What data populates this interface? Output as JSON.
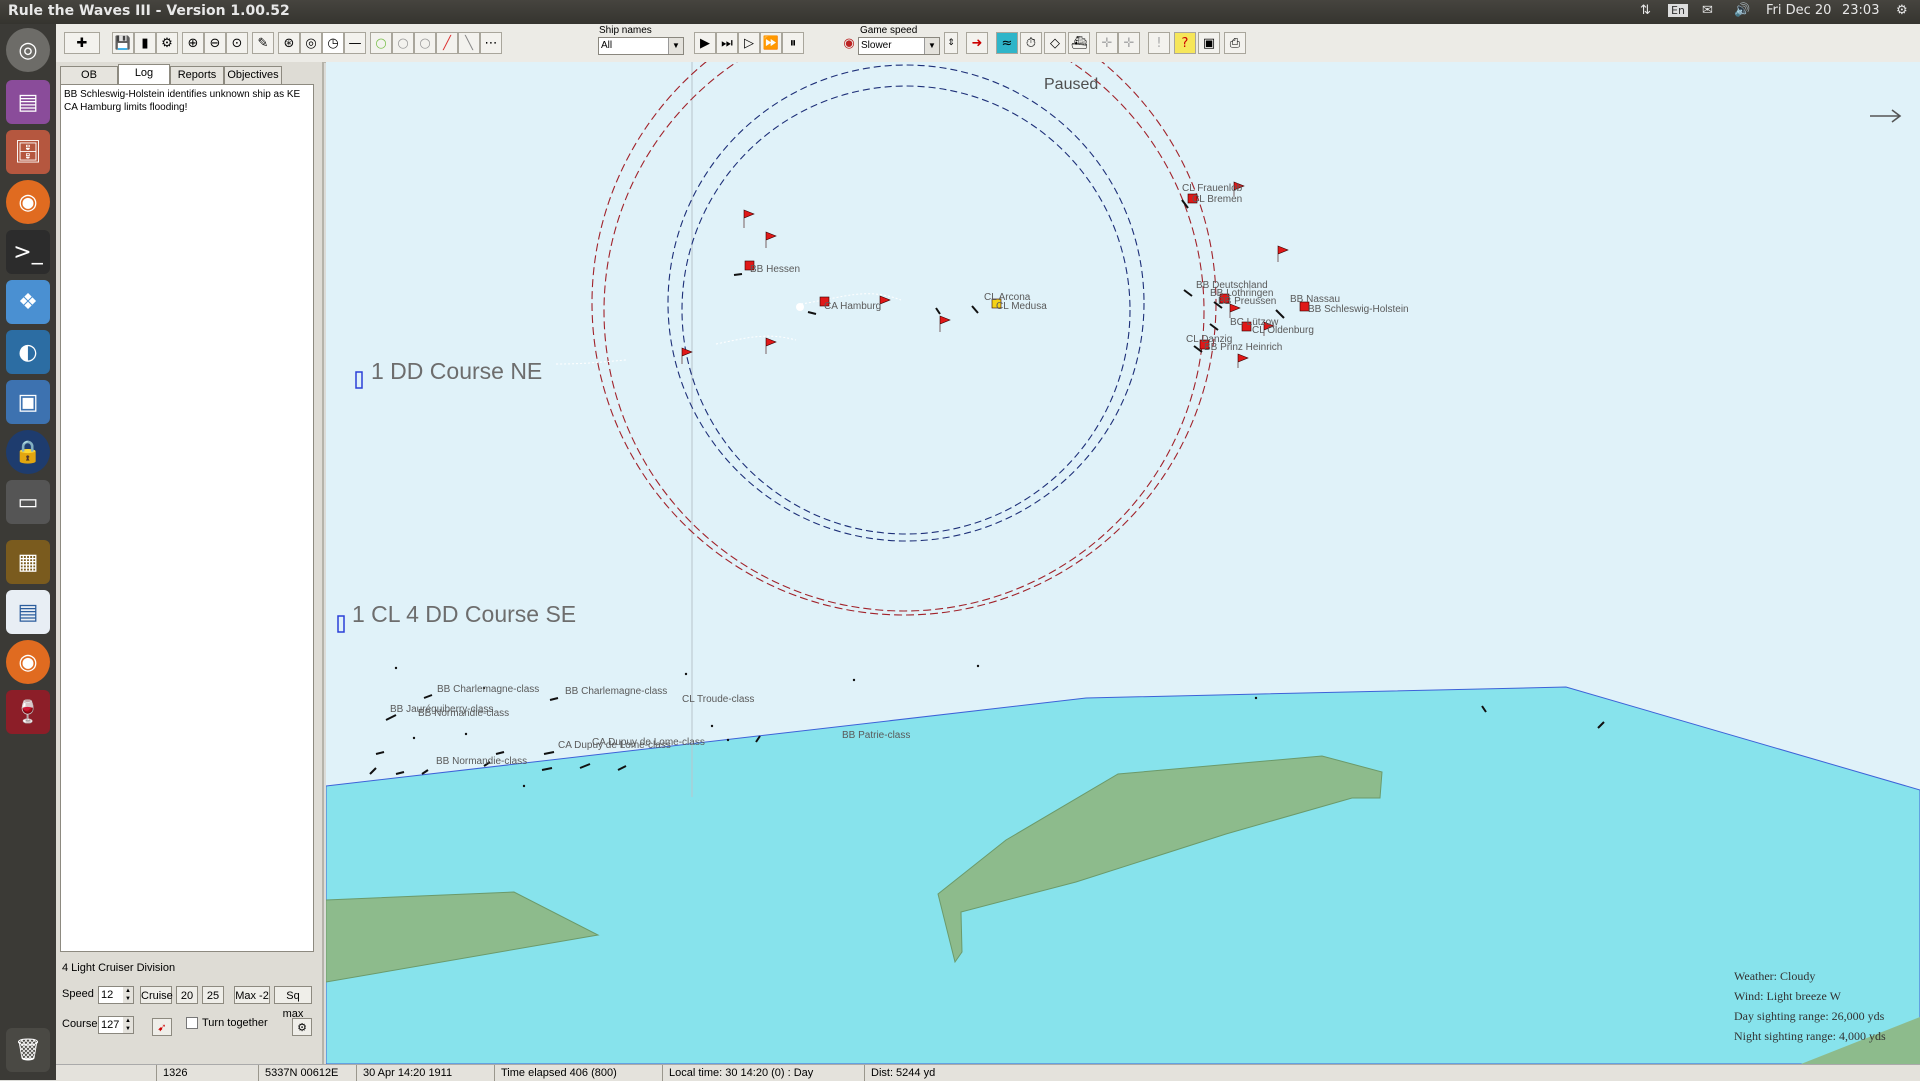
{
  "window": {
    "title": "Rule the Waves III - Version 1.00.52"
  },
  "system": {
    "lang": "En",
    "date": "Fri Dec 20",
    "time": "23:03"
  },
  "toolbar": {
    "ship_names_label": "Ship names",
    "ship_names_value": "All",
    "game_speed_label": "Game speed",
    "game_speed_value": "Slower"
  },
  "tabs": [
    "OB",
    "Log",
    "Reports",
    "Objectives"
  ],
  "log": [
    "BB Schleswig-Holstein identifies unknown ship as KE",
    "CA Hamburg limits flooding!"
  ],
  "division": {
    "name": "4 Light Cruiser Division",
    "speed_label": "Speed",
    "speed_value": "12",
    "speed_buttons": [
      "Cruise",
      "20",
      "25",
      "Max -2",
      "Sq max"
    ],
    "course_label": "Course",
    "course_value": "127",
    "turn_together": "Turn together"
  },
  "map": {
    "paused": "Paused",
    "groups": [
      "1 DD Course NE",
      "1 CL 4 DD Course SE"
    ],
    "friendly_labels": [
      "CL Frauenlob",
      "CL Bremen",
      "BB Hessen",
      "CA Hamburg",
      "CL Arcona",
      "CL Medusa",
      "BB Deutschland",
      "BB Lothringen",
      "BB Preussen",
      "BB Nassau",
      "BB Schleswig-Holstein",
      "BC Lützow",
      "CL Oldenburg",
      "CL Danzig",
      "BB Prinz Heinrich"
    ],
    "enemy_labels": [
      "BB Charlemagne-class",
      "BB Charlemagne-class",
      "CL Troude-class",
      "BB Jauréguiberry-class",
      "BB Normandie-class",
      "CA Dupuy de Lome-class",
      "CA Dupuy de Lome-class",
      "BB Patrie-class",
      "BB Normandie-class"
    ],
    "weather": {
      "weather": "Weather: Cloudy",
      "wind": "Wind: Light breeze  W",
      "day": "Day sighting range: 26,000 yds",
      "night": "Night sighting range: 4,000 yds"
    }
  },
  "status": {
    "turn": "1326",
    "position": "5337N 00612E",
    "date": "30 Apr 14:20 1911",
    "elapsed": "Time elapsed 406 (800)",
    "local": "Local time: 30 14:20 (0) : Day",
    "dist": "Dist: 5244 yd"
  },
  "colors": {
    "sea_light": "#e0f2f9",
    "sea_shallow": "#87e3ec",
    "land": "#8dbb8c",
    "ring_blue": "#1d2f78",
    "ring_red": "#a1222a",
    "flag_red": "#e01818"
  }
}
